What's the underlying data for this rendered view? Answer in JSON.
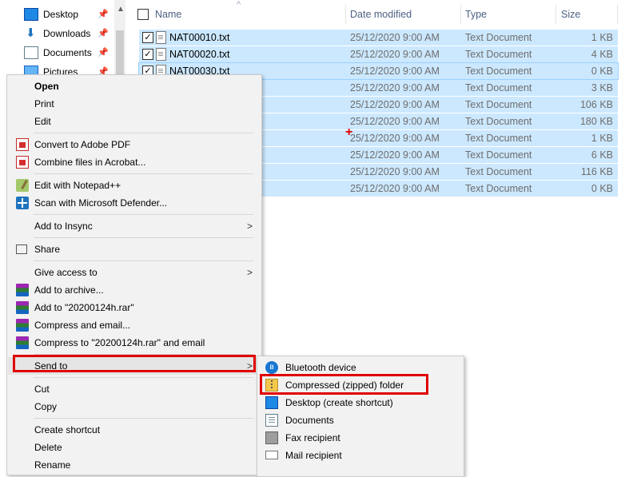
{
  "nav": {
    "items": [
      {
        "label": "Desktop",
        "icon": "desktop-icon"
      },
      {
        "label": "Downloads",
        "icon": "download-icon"
      },
      {
        "label": "Documents",
        "icon": "documents-icon"
      },
      {
        "label": "Pictures",
        "icon": "pictures-icon"
      }
    ],
    "scroll_up": "▲"
  },
  "columns": {
    "name": "Name",
    "date": "Date modified",
    "type": "Type",
    "size": "Size",
    "sort_arrow": "^"
  },
  "rows": [
    {
      "name": "NAT00010.txt",
      "date": "25/12/2020 9:00 AM",
      "type": "Text Document",
      "size": "1 KB"
    },
    {
      "name": "NAT00020.txt",
      "date": "25/12/2020 9:00 AM",
      "type": "Text Document",
      "size": "4 KB"
    },
    {
      "name": "NAT00030.txt",
      "date": "25/12/2020 9:00 AM",
      "type": "Text Document",
      "size": "0 KB"
    },
    {
      "name": "",
      "date": "25/12/2020 9:00 AM",
      "type": "Text Document",
      "size": "3 KB"
    },
    {
      "name": "",
      "date": "25/12/2020 9:00 AM",
      "type": "Text Document",
      "size": "106 KB"
    },
    {
      "name": "",
      "date": "25/12/2020 9:00 AM",
      "type": "Text Document",
      "size": "180 KB"
    },
    {
      "name": "",
      "date": "25/12/2020 9:00 AM",
      "type": "Text Document",
      "size": "1 KB"
    },
    {
      "name": "",
      "date": "25/12/2020 9:00 AM",
      "type": "Text Document",
      "size": "6 KB"
    },
    {
      "name": "",
      "date": "25/12/2020 9:00 AM",
      "type": "Text Document",
      "size": "116 KB"
    },
    {
      "name": "",
      "date": "25/12/2020 9:00 AM",
      "type": "Text Document",
      "size": "0 KB"
    }
  ],
  "checkmark": "✓",
  "cursor": "+",
  "context_menu": {
    "open": "Open",
    "print": "Print",
    "edit": "Edit",
    "convert_pdf": "Convert to Adobe PDF",
    "combine_acrobat": "Combine files in Acrobat...",
    "edit_notepad": "Edit with Notepad++",
    "scan_defender": "Scan with Microsoft Defender...",
    "add_insync": "Add to Insync",
    "share": "Share",
    "give_access": "Give access to",
    "add_archive": "Add to archive...",
    "add_rar": "Add to \"20200124h.rar\"",
    "compress_email": "Compress and email...",
    "compress_rar_email": "Compress to \"20200124h.rar\" and email",
    "send_to": "Send to",
    "cut": "Cut",
    "copy": "Copy",
    "create_shortcut": "Create shortcut",
    "delete": "Delete",
    "rename": "Rename",
    "submenu_arrow": ">"
  },
  "send_to_menu": {
    "bluetooth": "Bluetooth device",
    "zip": "Compressed (zipped) folder",
    "desktop": "Desktop (create shortcut)",
    "documents": "Documents",
    "fax": "Fax recipient",
    "mail": "Mail recipient"
  },
  "colors": {
    "selection": "#cce8ff",
    "highlight_box": "#e00000",
    "menu_bg": "#f2f2f2"
  }
}
